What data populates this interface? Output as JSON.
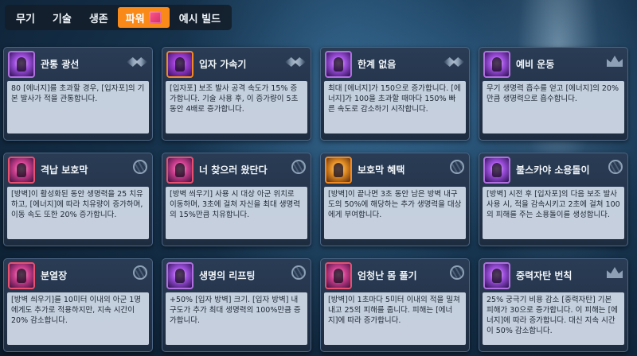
{
  "tabs": [
    {
      "label": "무기",
      "active": false
    },
    {
      "label": "기술",
      "active": false
    },
    {
      "label": "생존",
      "active": false
    },
    {
      "label": "파워",
      "active": true
    },
    {
      "label": "예시 빌드",
      "active": false
    }
  ],
  "cards": [
    {
      "title": "관통 광선",
      "icon": "beam-icon",
      "rank": "wing-icon",
      "desc": "80 [에너지]를 초과할 경우, [입자포]의 기본 발사가 적을 관통합니다."
    },
    {
      "title": "입자 가속기",
      "icon": "accelerator-icon",
      "rank": "wing-icon",
      "desc": "[입자포] 보조 발사 공격 속도가 15% 증가합니다. 기술 사용 후, 이 증가량이 5초 동안 4배로 증가합니다."
    },
    {
      "title": "한계 없음",
      "icon": "orb-icon",
      "rank": "wing-icon",
      "desc": "최대 [에너지]가 150으로 증가합니다. [에너지]가 100을 초과할 때마다 150% 빠른 속도로 감소하기 시작합니다."
    },
    {
      "title": "예비 운동",
      "icon": "energy-icon",
      "rank": "crown-icon",
      "desc": "무기 생명력 흡수를 얻고 [에너지]의 20%만큼 생명력으로 흡수합니다."
    },
    {
      "title": "격납 보호막",
      "icon": "shield-icon",
      "rank": "hex-icon",
      "desc": "[방벽]이 활성화된 동안 생명력을 25 치유하고, [에너지]에 따라 치유량이 증가하며, 이동 속도 또한 20% 증가합니다."
    },
    {
      "title": "너 찾으러 왔단다",
      "icon": "figure-icon",
      "rank": "hex-icon",
      "desc": "[방벽 씌우기] 사용 시 대상 아군 위치로 이동하며, 3초에 걸쳐 자신을 최대 생명력의 15%만큼 치유합니다."
    },
    {
      "title": "보호막 혜택",
      "icon": "plus-icon",
      "rank": "hex-icon",
      "desc": "[방벽]이 끝나면 3초 동안 남은 방벽 내구도의 50%에 해당하는 추가 생명력을 대상에게 부여합니다."
    },
    {
      "title": "불스카야 소용돌이",
      "icon": "vortex-icon",
      "rank": "hex-icon",
      "desc": "[방벽] 시전 후 [입자포]의 다음 보조 발사 사용 시, 적을 감속시키고 2초에 걸쳐 100의 피해를 주는 소용돌이를 생성합니다."
    },
    {
      "title": "분열장",
      "icon": "field-icon",
      "rank": "hex-icon",
      "desc": "[방벽 씌우기]를 10미터 이내의 아군 1명에게도 추가로 적용하지만, 지속 시간이 20% 감소합니다."
    },
    {
      "title": "생명의 리프팅",
      "icon": "health-plus-icon",
      "rank": "hex-icon",
      "desc": "+50% [입자 방벽] 크기. [입자 방벽] 내구도가 추가 최대 생명력의 100%만큼 증가합니다."
    },
    {
      "title": "엄청난 몸 풀기",
      "icon": "burst-icon",
      "rank": "hex-icon",
      "desc": "[방벽]이 1초마다 5미터 이내의 적을 밀쳐내고 25의 피해를 줍니다. 피해는 [에너지]에 따라 증가합니다."
    },
    {
      "title": "중력자탄 번칙",
      "icon": "graviton-icon",
      "rank": "crown-icon",
      "desc": "25% 궁극기 비용 감소 [중력자탄] 기본 피해가 30으로 증가합니다. 이 피해는 [에너지]에 따라 증가합니다. 대신 지속 시간이 50% 감소합니다."
    }
  ]
}
